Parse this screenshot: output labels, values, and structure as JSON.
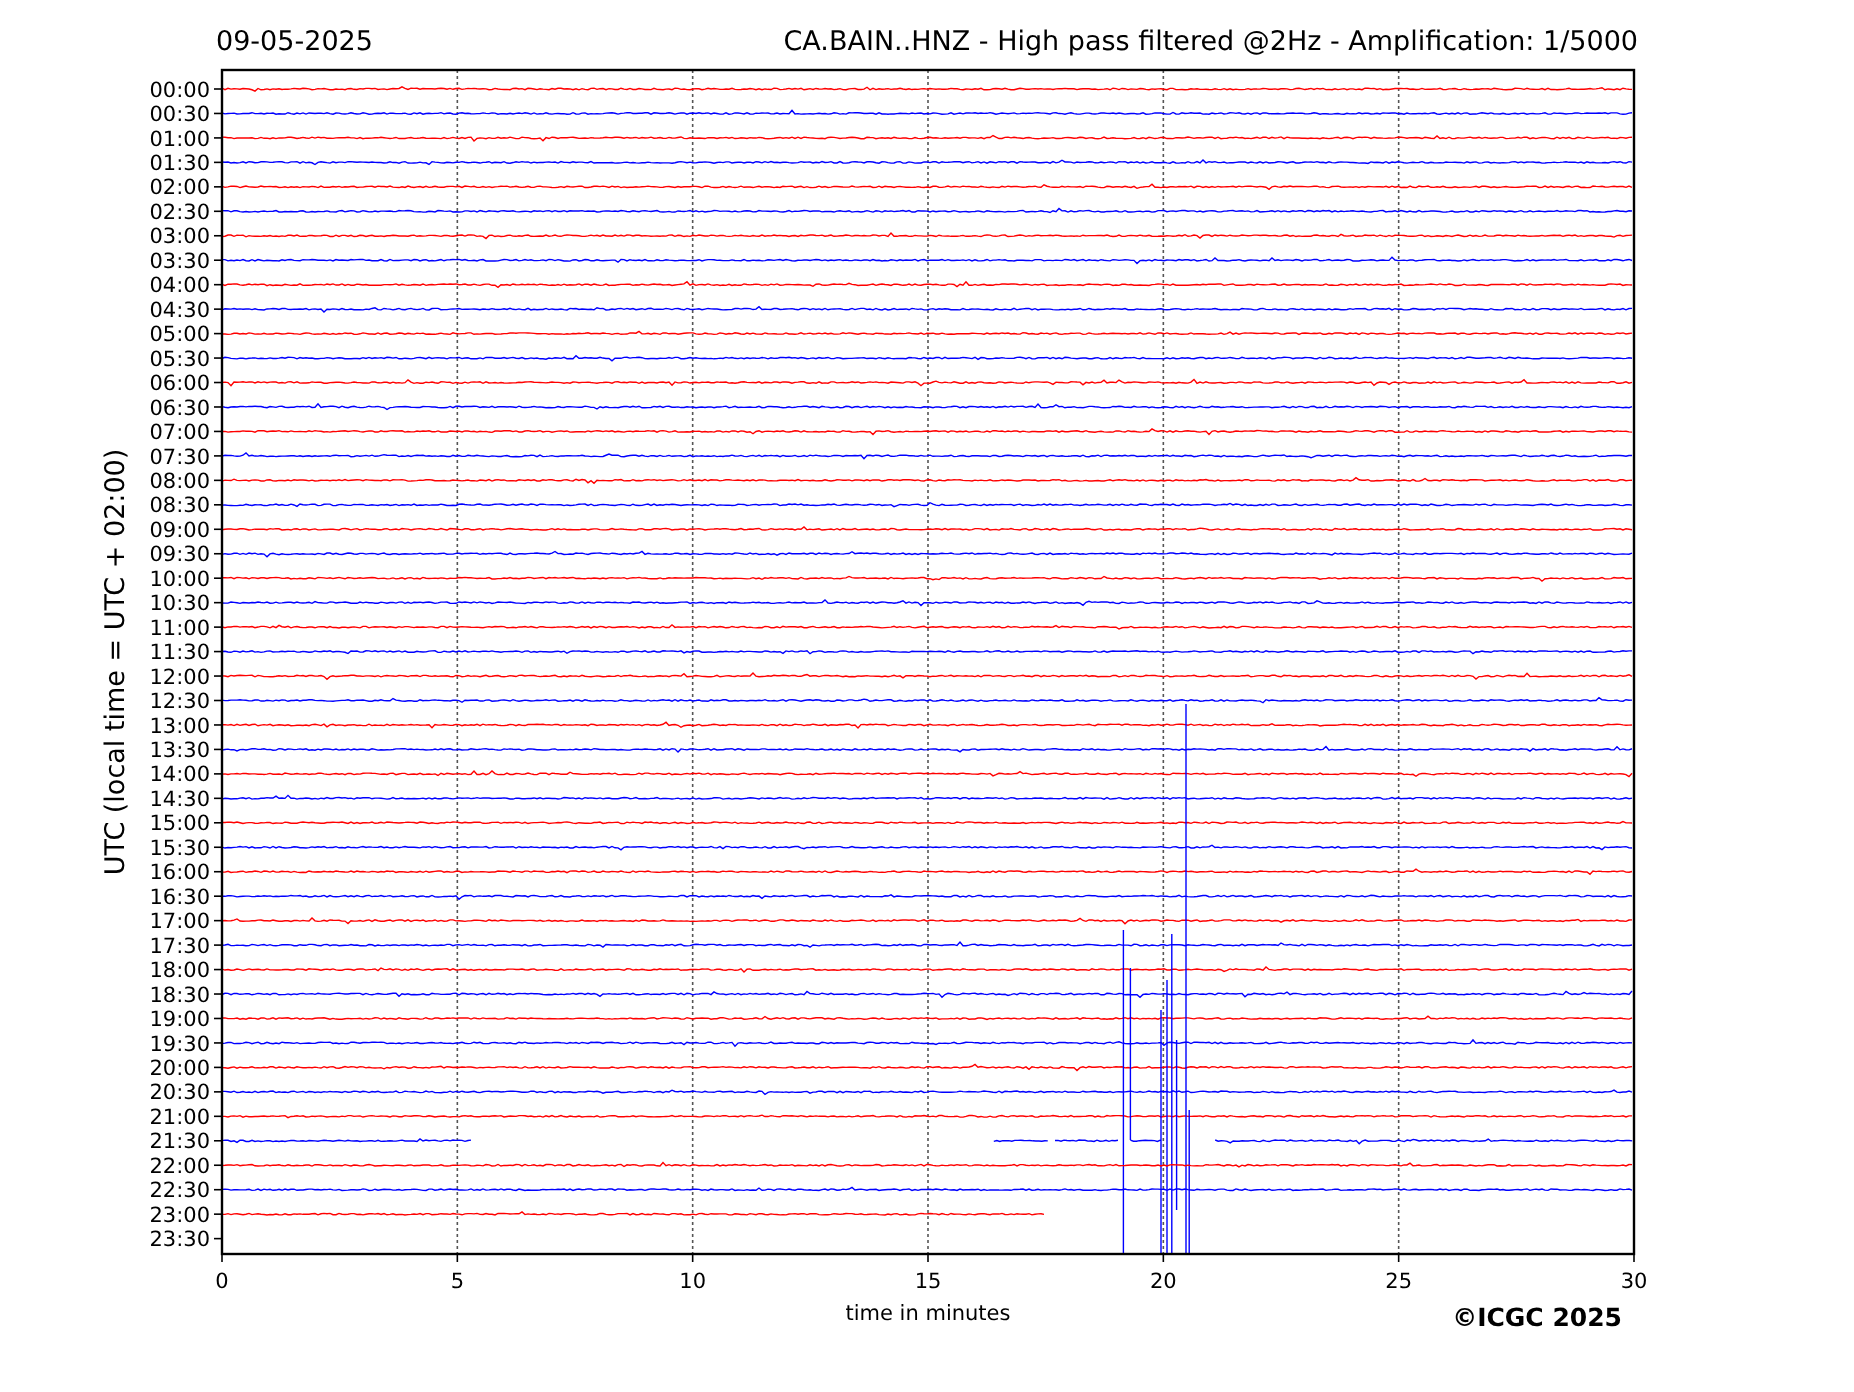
{
  "header": {
    "date": "09-05-2025",
    "title": "CA.BAIN..HNZ - High pass filtered @2Hz - Amplification: 1/5000"
  },
  "axes": {
    "ylabel": "UTC (local time = UTC + 02:00)",
    "xlabel": "time in minutes",
    "xticks": [
      "0",
      "5",
      "10",
      "15",
      "20",
      "25",
      "30"
    ]
  },
  "rows": [
    {
      "label": "00:00",
      "color": "#ff0000",
      "kind": "full"
    },
    {
      "label": "00:30",
      "color": "#0000ff",
      "kind": "full"
    },
    {
      "label": "01:00",
      "color": "#ff0000",
      "kind": "full"
    },
    {
      "label": "01:30",
      "color": "#0000ff",
      "kind": "full"
    },
    {
      "label": "02:00",
      "color": "#ff0000",
      "kind": "full"
    },
    {
      "label": "02:30",
      "color": "#0000ff",
      "kind": "full"
    },
    {
      "label": "03:00",
      "color": "#ff0000",
      "kind": "full"
    },
    {
      "label": "03:30",
      "color": "#0000ff",
      "kind": "full"
    },
    {
      "label": "04:00",
      "color": "#ff0000",
      "kind": "full"
    },
    {
      "label": "04:30",
      "color": "#0000ff",
      "kind": "full"
    },
    {
      "label": "05:00",
      "color": "#ff0000",
      "kind": "full"
    },
    {
      "label": "05:30",
      "color": "#0000ff",
      "kind": "full"
    },
    {
      "label": "06:00",
      "color": "#ff0000",
      "kind": "full"
    },
    {
      "label": "06:30",
      "color": "#0000ff",
      "kind": "full"
    },
    {
      "label": "07:00",
      "color": "#ff0000",
      "kind": "full"
    },
    {
      "label": "07:30",
      "color": "#0000ff",
      "kind": "full"
    },
    {
      "label": "08:00",
      "color": "#ff0000",
      "kind": "full"
    },
    {
      "label": "08:30",
      "color": "#0000ff",
      "kind": "full"
    },
    {
      "label": "09:00",
      "color": "#ff0000",
      "kind": "full"
    },
    {
      "label": "09:30",
      "color": "#0000ff",
      "kind": "full"
    },
    {
      "label": "10:00",
      "color": "#ff0000",
      "kind": "full"
    },
    {
      "label": "10:30",
      "color": "#0000ff",
      "kind": "full"
    },
    {
      "label": "11:00",
      "color": "#ff0000",
      "kind": "full"
    },
    {
      "label": "11:30",
      "color": "#0000ff",
      "kind": "full"
    },
    {
      "label": "12:00",
      "color": "#ff0000",
      "kind": "full"
    },
    {
      "label": "12:30",
      "color": "#0000ff",
      "kind": "full"
    },
    {
      "label": "13:00",
      "color": "#ff0000",
      "kind": "full"
    },
    {
      "label": "13:30",
      "color": "#0000ff",
      "kind": "full"
    },
    {
      "label": "14:00",
      "color": "#ff0000",
      "kind": "full"
    },
    {
      "label": "14:30",
      "color": "#0000ff",
      "kind": "full"
    },
    {
      "label": "15:00",
      "color": "#ff0000",
      "kind": "full"
    },
    {
      "label": "15:30",
      "color": "#0000ff",
      "kind": "full"
    },
    {
      "label": "16:00",
      "color": "#ff0000",
      "kind": "full"
    },
    {
      "label": "16:30",
      "color": "#0000ff",
      "kind": "full"
    },
    {
      "label": "17:00",
      "color": "#ff0000",
      "kind": "full"
    },
    {
      "label": "17:30",
      "color": "#0000ff",
      "kind": "full"
    },
    {
      "label": "18:00",
      "color": "#ff0000",
      "kind": "full"
    },
    {
      "label": "18:30",
      "color": "#0000ff",
      "kind": "full"
    },
    {
      "label": "19:00",
      "color": "#ff0000",
      "kind": "full"
    },
    {
      "label": "19:30",
      "color": "#0000ff",
      "kind": "full"
    },
    {
      "label": "20:00",
      "color": "#ff0000",
      "kind": "full"
    },
    {
      "label": "20:30",
      "color": "#0000ff",
      "kind": "full"
    },
    {
      "label": "21:00",
      "color": "#ff0000",
      "kind": "full"
    },
    {
      "label": "21:30",
      "color": "#0000ff",
      "kind": "event"
    },
    {
      "label": "22:00",
      "color": "#ff0000",
      "kind": "full"
    },
    {
      "label": "22:30",
      "color": "#0000ff",
      "kind": "full"
    },
    {
      "label": "23:00",
      "color": "#ff0000",
      "kind": "partial"
    },
    {
      "label": "23:30",
      "kind": "none"
    }
  ],
  "copyright": "©ICGC 2025"
}
